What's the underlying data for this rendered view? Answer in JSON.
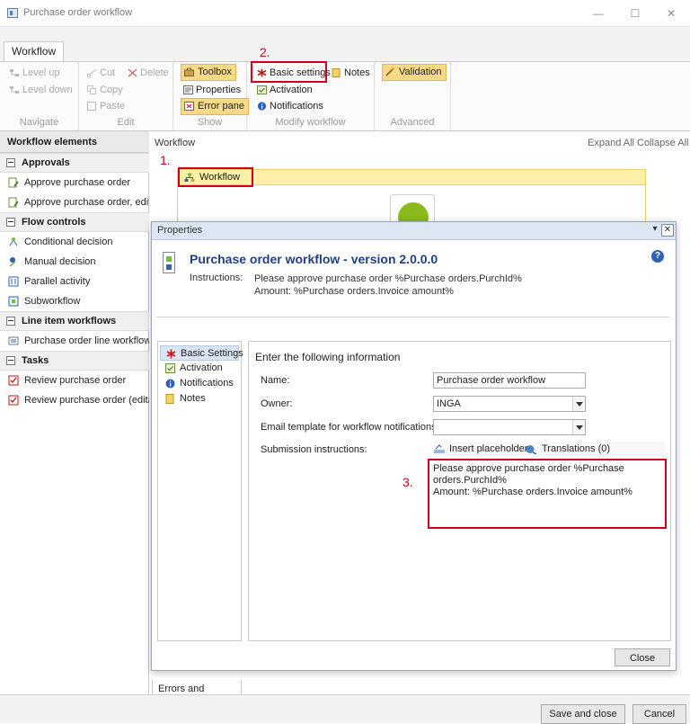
{
  "window": {
    "title": "Purchase order workflow",
    "controls": {
      "minimize": "—",
      "maximize": "☐",
      "close": "✕"
    }
  },
  "ribbon": {
    "active_tab": "Workflow",
    "groups": {
      "navigate": {
        "label": "Navigate",
        "level_up": "Level up",
        "level_down": "Level down"
      },
      "edit": {
        "label": "Edit",
        "cut": "Cut",
        "delete": "Delete",
        "copy": "Copy",
        "paste": "Paste"
      },
      "show": {
        "label": "Show",
        "toolbox": "Toolbox",
        "properties": "Properties",
        "error_pane": "Error pane"
      },
      "modify": {
        "label": "Modify workflow",
        "basic_settings": "Basic settings",
        "notes": "Notes",
        "activation": "Activation",
        "notifications": "Notifications"
      },
      "advanced": {
        "label": "Advanced",
        "validation": "Validation"
      }
    }
  },
  "annotations": {
    "one": "1.",
    "two": "2.",
    "three": "3."
  },
  "left_panel": {
    "heading": "Workflow elements",
    "sections": [
      {
        "title": "Approvals",
        "items": [
          "Approve purchase order",
          "Approve purchase order, editable"
        ]
      },
      {
        "title": "Flow controls",
        "items": [
          "Conditional decision",
          "Manual decision",
          "Parallel activity",
          "Subworkflow"
        ]
      },
      {
        "title": "Line item workflows",
        "items": [
          "Purchase order line workflow"
        ]
      },
      {
        "title": "Tasks",
        "items": [
          "Review purchase order",
          "Review purchase order (editable)"
        ]
      }
    ]
  },
  "canvas": {
    "label": "Workflow",
    "expand_all": "Expand All",
    "collapse_all": "Collapse All",
    "workflow_node": "Workflow",
    "errors_tab": "Errors and warnings"
  },
  "dialog": {
    "title": "Properties",
    "heading": "Purchase order workflow - version 2.0.0.0",
    "instructions_label": "Instructions:",
    "instructions_line1": "Please approve purchase order %Purchase orders.PurchId%",
    "instructions_line2": "Amount: %Purchase orders.Invoice amount%",
    "help": "?",
    "nav": [
      "Basic Settings",
      "Activation",
      "Notifications",
      "Notes"
    ],
    "form": {
      "heading": "Enter the following information",
      "name_label": "Name:",
      "name_value": "Purchase order workflow",
      "owner_label": "Owner:",
      "owner_value": "INGA",
      "email_label": "Email template for workflow notifications:",
      "email_value": "",
      "submission_label": "Submission instructions:",
      "insert_placeholder": "Insert placeholder",
      "translations": "Translations (0)",
      "instructions_line1": "Please approve purchase order %Purchase",
      "instructions_line2": "orders.PurchId%",
      "instructions_line3": "Amount: %Purchase orders.Invoice amount%"
    },
    "close_button": "Close"
  },
  "footer": {
    "save_close": "Save and close",
    "cancel": "Cancel"
  },
  "colors": {
    "highlight": "#f8d987",
    "annotation_red": "#d0021b",
    "heading_blue": "#1f3f86",
    "workflow_bar": "#fdf1a8",
    "start_node": "#8aba1d"
  }
}
